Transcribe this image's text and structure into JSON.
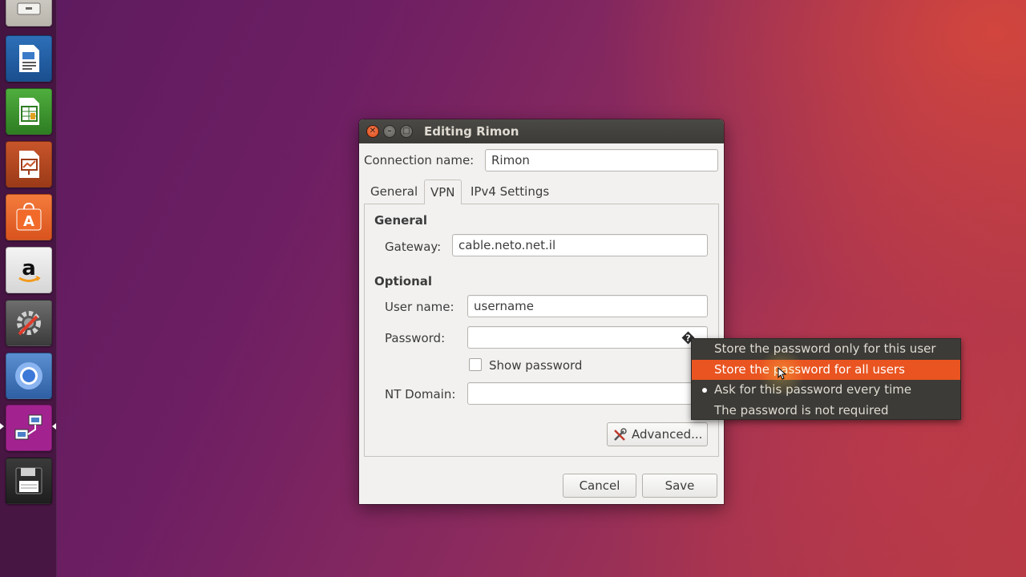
{
  "launcher": {
    "items": [
      {
        "name": "Files"
      },
      {
        "name": "LibreOffice Writer"
      },
      {
        "name": "LibreOffice Calc"
      },
      {
        "name": "LibreOffice Impress"
      },
      {
        "name": "Ubuntu Software"
      },
      {
        "name": "Amazon"
      },
      {
        "name": "System Settings"
      },
      {
        "name": "Chromium"
      },
      {
        "name": "Network Connections"
      },
      {
        "name": "Save"
      }
    ],
    "amazon_glyph": "a"
  },
  "dialog": {
    "title": "Editing Rimon",
    "connection_name_label": "Connection name:",
    "connection_name_value": "Rimon",
    "tabs": [
      {
        "label": "General"
      },
      {
        "label": "VPN"
      },
      {
        "label": "IPv4 Settings"
      }
    ],
    "active_tab": "VPN",
    "vpn": {
      "general_heading": "General",
      "gateway_label": "Gateway:",
      "gateway_value": "cable.neto.net.il",
      "optional_heading": "Optional",
      "username_label": "User name:",
      "username_value": "username",
      "password_label": "Password:",
      "password_value": "",
      "show_password_label": "Show password",
      "show_password_checked": false,
      "nt_domain_label": "NT Domain:",
      "nt_domain_value": "",
      "advanced_label": "Advanced..."
    },
    "cancel_label": "Cancel",
    "save_label": "Save"
  },
  "password_menu": {
    "items": [
      {
        "label": "Store the password only for this user",
        "highlighted": false,
        "selected": false
      },
      {
        "label": "Store the password for all users",
        "highlighted": true,
        "selected": false
      },
      {
        "label": "Ask for this password every time",
        "highlighted": false,
        "selected": true
      },
      {
        "label": "The password is not required",
        "highlighted": false,
        "selected": false
      }
    ]
  },
  "colors": {
    "accent": "#e95420",
    "titlebar": "#3c3b37",
    "dialog_bg": "#f2f1f0"
  }
}
